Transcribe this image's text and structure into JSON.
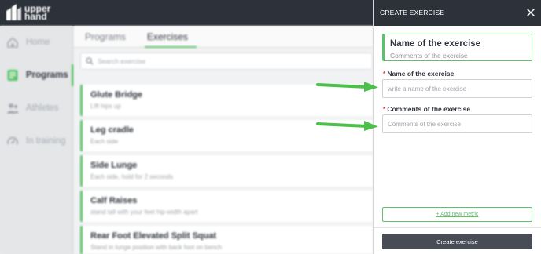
{
  "app": {
    "logo_text_line1": "upper",
    "logo_text_line2": "hand"
  },
  "sidebar": {
    "items": [
      {
        "label": "Home",
        "icon": "home-icon",
        "active": false
      },
      {
        "label": "Programs",
        "icon": "programs-icon",
        "active": true
      },
      {
        "label": "Athletes",
        "icon": "athletes-icon",
        "active": false
      },
      {
        "label": "In training",
        "icon": "in-training-icon",
        "active": false
      }
    ]
  },
  "main": {
    "tabs": [
      {
        "label": "Programs",
        "active": false
      },
      {
        "label": "Exercises",
        "active": true
      }
    ],
    "search_placeholder": "Search exercise",
    "exercises": [
      {
        "name": "Glute Bridge",
        "note": "Lift hips up"
      },
      {
        "name": "Leg cradle",
        "note": "Each side"
      },
      {
        "name": "Side Lunge",
        "note": "Each side, hold for 2 seconds"
      },
      {
        "name": "Calf Raises",
        "note": "stand tall with your feet hip-width apart"
      },
      {
        "name": "Rear Foot Elevated Split Squat",
        "note": "Stand in lunge position with back foot on bench"
      }
    ]
  },
  "panel": {
    "title": "CREATE EXERCISE",
    "preview_name": "Name of the exercise",
    "preview_comment": "Comments of the exercise",
    "name_label": "Name of the exercise",
    "name_placeholder": "write a name of the exercise",
    "comments_label": "Comments of the exercise",
    "comments_placeholder": "Comments of the exercise",
    "required_mark": "*",
    "add_metric_label": "+ Add new metric",
    "create_button_label": "Create exercise"
  },
  "colors": {
    "accent_green": "#5ec26a",
    "header_dark": "#2c313a",
    "required_red": "#d9373b",
    "button_dark": "#474c55"
  }
}
